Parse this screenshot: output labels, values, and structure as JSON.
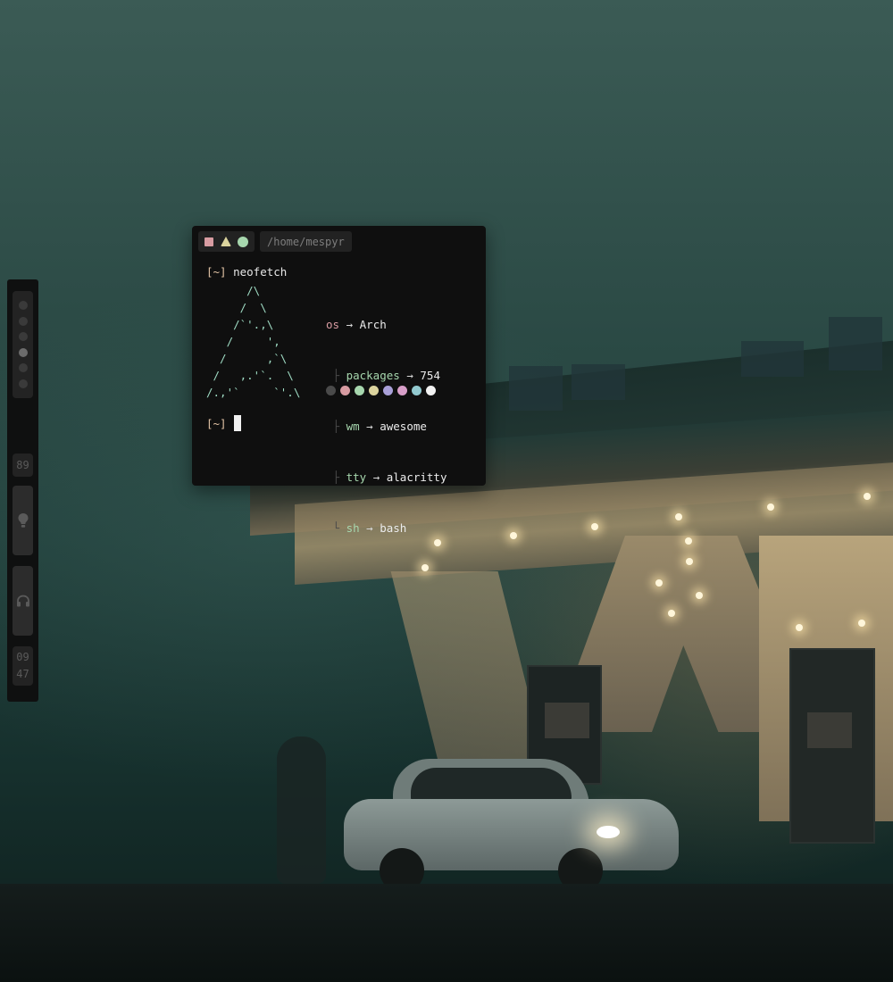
{
  "terminal": {
    "path": "/home/mespyr",
    "prompt": "[~]",
    "command": "neofetch",
    "ascii_logo": "      /\\\n     /  \\\n    /`'.,\\\n   /     ',\n  /      ,`\\\n /   ,.'`.  \\\n/.,'`     `'.\\",
    "info": {
      "os_key": "os",
      "os_value": "Arch",
      "packages_key": "packages",
      "packages_value": "754",
      "wm_key": "wm",
      "wm_value": "awesome",
      "tty_key": "tty",
      "tty_value": "alacritty",
      "sh_key": "sh",
      "sh_value": "bash",
      "arrow": "→"
    },
    "palette": [
      "#4a4a4a",
      "#d89ca2",
      "#a7d7ae",
      "#dcd49e",
      "#a9a0d8",
      "#d89fc9",
      "#92c9cf",
      "#f2f2f2"
    ]
  },
  "sidebar": {
    "workspaces": [
      {
        "active": false
      },
      {
        "active": false
      },
      {
        "active": false
      },
      {
        "active": true
      },
      {
        "active": false
      },
      {
        "active": false
      }
    ],
    "level": "89",
    "clock_hour": "09",
    "clock_minute": "47"
  },
  "colors": {
    "terminal_bg": "#0f0f0f",
    "accent_red": "#d89ca2",
    "accent_green": "#a7d7ae",
    "accent_yellow": "#dcd49e"
  }
}
